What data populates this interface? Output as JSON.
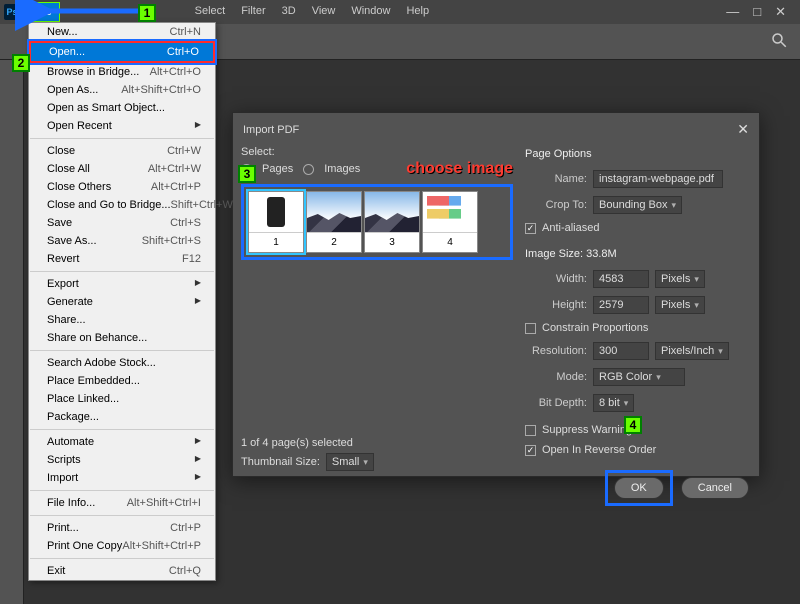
{
  "menubar": {
    "file": "File",
    "hidden_edit": "",
    "select": "Select",
    "filter": "Filter",
    "threeD": "3D",
    "view": "View",
    "window": "Window",
    "help": "Help"
  },
  "fileMenu": {
    "new": {
      "label": "New...",
      "shortcut": "Ctrl+N"
    },
    "open": {
      "label": "Open...",
      "shortcut": "Ctrl+O"
    },
    "browseBridge": {
      "label": "Browse in Bridge...",
      "shortcut": "Alt+Ctrl+O"
    },
    "openAs": {
      "label": "Open As...",
      "shortcut": "Alt+Shift+Ctrl+O"
    },
    "openSmart": {
      "label": "Open as Smart Object..."
    },
    "openRecent": {
      "label": "Open Recent"
    },
    "close": {
      "label": "Close",
      "shortcut": "Ctrl+W"
    },
    "closeAll": {
      "label": "Close All",
      "shortcut": "Alt+Ctrl+W"
    },
    "closeOthers": {
      "label": "Close Others",
      "shortcut": "Alt+Ctrl+P"
    },
    "closeBridge": {
      "label": "Close and Go to Bridge...",
      "shortcut": "Shift+Ctrl+W"
    },
    "save": {
      "label": "Save",
      "shortcut": "Ctrl+S"
    },
    "saveAs": {
      "label": "Save As...",
      "shortcut": "Shift+Ctrl+S"
    },
    "revert": {
      "label": "Revert",
      "shortcut": "F12"
    },
    "export": {
      "label": "Export"
    },
    "generate": {
      "label": "Generate"
    },
    "share": {
      "label": "Share..."
    },
    "shareBehance": {
      "label": "Share on Behance..."
    },
    "searchStock": {
      "label": "Search Adobe Stock..."
    },
    "placeEmbedded": {
      "label": "Place Embedded..."
    },
    "placeLinked": {
      "label": "Place Linked..."
    },
    "package": {
      "label": "Package..."
    },
    "automate": {
      "label": "Automate"
    },
    "scripts": {
      "label": "Scripts"
    },
    "import": {
      "label": "Import"
    },
    "fileInfo": {
      "label": "File Info...",
      "shortcut": "Alt+Shift+Ctrl+I"
    },
    "print": {
      "label": "Print...",
      "shortcut": "Ctrl+P"
    },
    "printOne": {
      "label": "Print One Copy",
      "shortcut": "Alt+Shift+Ctrl+P"
    },
    "exit": {
      "label": "Exit",
      "shortcut": "Ctrl+Q"
    }
  },
  "dialog": {
    "title": "Import PDF",
    "selectLabel": "Select:",
    "pages": "Pages",
    "images": "Images",
    "chooseImage": "choose image",
    "thumbs": [
      "1",
      "2",
      "3",
      "4"
    ],
    "selectedText": "1 of 4 page(s) selected",
    "thumbSizeLabel": "Thumbnail Size:",
    "thumbSize": "Small",
    "pageOptions": "Page Options",
    "nameLabel": "Name:",
    "name": "instagram-webpage.pdf",
    "cropToLabel": "Crop To:",
    "cropTo": "Bounding Box",
    "antiAliased": "Anti-aliased",
    "imageSizeHeader": "Image Size: 33.8M",
    "widthLabel": "Width:",
    "width": "4583",
    "widthUnit": "Pixels",
    "heightLabel": "Height:",
    "height": "2579",
    "heightUnit": "Pixels",
    "constrain": "Constrain Proportions",
    "resolutionLabel": "Resolution:",
    "resolution": "300",
    "resolutionUnit": "Pixels/Inch",
    "modeLabel": "Mode:",
    "mode": "RGB Color",
    "bitDepthLabel": "Bit Depth:",
    "bitDepth": "8 bit",
    "suppress": "Suppress Warnings",
    "reverse": "Open In Reverse Order",
    "ok": "OK",
    "cancel": "Cancel"
  },
  "badges": {
    "b1": "1",
    "b2": "2",
    "b3": "3",
    "b4": "4"
  }
}
